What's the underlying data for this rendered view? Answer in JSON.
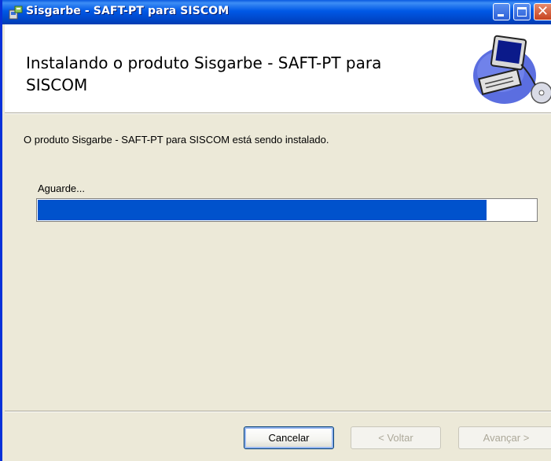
{
  "window": {
    "title": "Sisgarbe - SAFT-PT para SISCOM",
    "controls": [
      "minimize-icon",
      "maximize-icon",
      "close-icon"
    ]
  },
  "header": {
    "title": "Instalando o produto Sisgarbe - SAFT-PT para SISCOM",
    "art": "computer-install-icon"
  },
  "body": {
    "message": "O produto Sisgarbe - SAFT-PT para SISCOM está sendo instalado.",
    "status_label": "Aguarde...",
    "progress_percent": 90
  },
  "buttons": {
    "cancel": "Cancelar",
    "back": "< Voltar",
    "next": "Avançar >"
  },
  "colors": {
    "titlebar": "#0058e6",
    "progress_fill": "#0052cc",
    "dialog_bg": "#ece9d8"
  }
}
